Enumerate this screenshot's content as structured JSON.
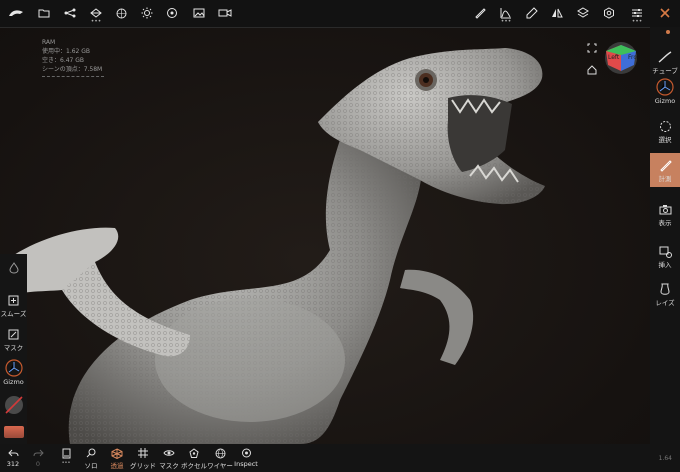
{
  "stats": {
    "title": "RAM",
    "used": "使用中：1.62 GB",
    "free": "空き：6.47 GB",
    "vertices": "シーンの頂点：7.58M"
  },
  "viewcube": {
    "left": "Left",
    "front": "Fro"
  },
  "right_panel": {
    "tube": "チューブ",
    "gizmo": "Gizmo",
    "select": "選択",
    "measure": "計測",
    "view": "表示",
    "insert": "挿入",
    "lathe": "レイズ"
  },
  "left_panel": {
    "smooth": "スムーズ",
    "mask": "マスク",
    "gizmo": "Gizmo"
  },
  "bottom": {
    "undo_count": "312",
    "redo_count": "0",
    "solo": "ソロ",
    "transparent": "透過",
    "grid": "グリッド",
    "mask": "マスク",
    "voxel": "ボクセル",
    "wire": "ワイヤー",
    "inspect": "Inspect"
  },
  "version": "1.64",
  "colors": {
    "accent": "#c7815f",
    "toolbar": "#121212"
  }
}
